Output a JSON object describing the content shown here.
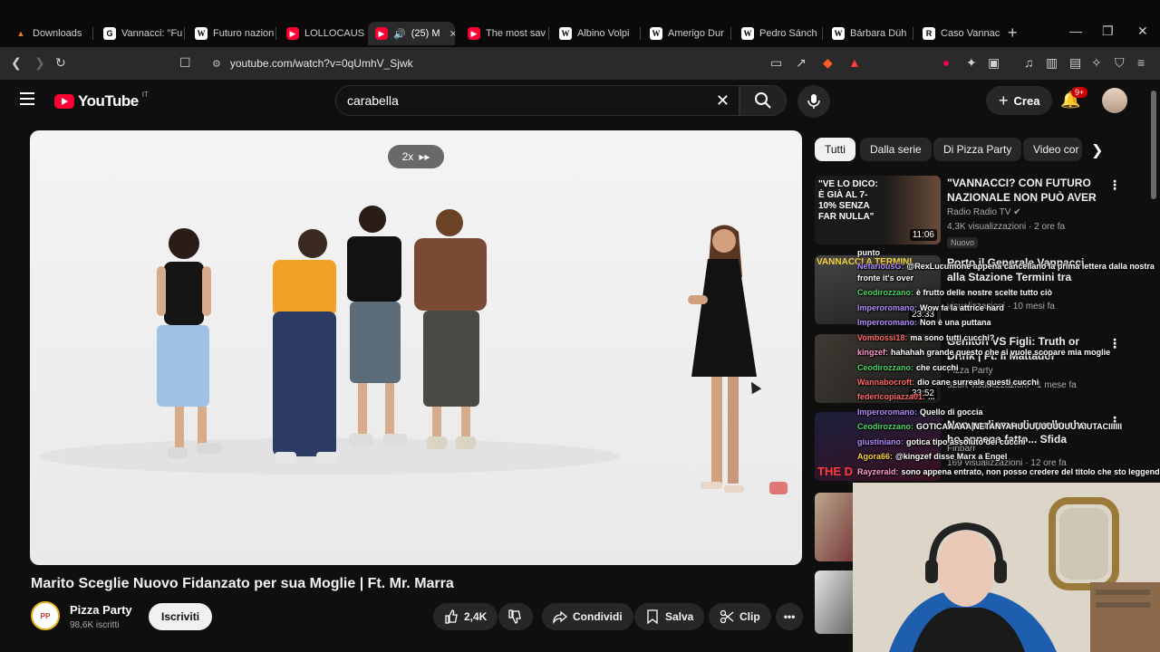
{
  "browser": {
    "tabs": [
      {
        "label": "Downloads",
        "icon": "download-icon"
      },
      {
        "label": "Vannacci: \"Fu",
        "icon": "g-icon"
      },
      {
        "label": "Futuro nazion",
        "icon": "wikipedia-icon"
      },
      {
        "label": "LOLLOCAUST",
        "icon": "youtube-icon"
      },
      {
        "label": "(25) M",
        "icon": "youtube-icon"
      },
      {
        "label": "The most sav",
        "icon": "youtube-icon"
      },
      {
        "label": "Albino Volpi",
        "icon": "wikipedia-icon"
      },
      {
        "label": "Amerigo Dur",
        "icon": "wikipedia-icon"
      },
      {
        "label": "Pedro Sánch",
        "icon": "wikipedia-icon"
      },
      {
        "label": "Bárbara Düh",
        "icon": "wikipedia-icon"
      },
      {
        "label": "Caso Vannac",
        "icon": "r-icon"
      }
    ],
    "url": "youtube.com/watch?v=0qUmhV_Sjwk"
  },
  "youtube": {
    "logo_text": "YouTube",
    "country_code": "IT",
    "search_value": "carabella",
    "create_label": "Crea",
    "notification_badge": "9+"
  },
  "player": {
    "speed_label": "2x"
  },
  "video": {
    "title": "Marito Sceglie Nuovo Fidanzato per sua Moglie | Ft. Mr. Marra",
    "channel": "Pizza Party",
    "subscribers": "98,6K iscritti",
    "subscribe_label": "Iscriviti",
    "likes": "2,4K",
    "share_label": "Condividi",
    "save_label": "Salva",
    "clip_label": "Clip"
  },
  "chips": [
    "Tutti",
    "Dalla serie",
    "Di Pizza Party",
    "Video cor"
  ],
  "recommendations": [
    {
      "title": "\"VANNACCI? CON FUTURO NAZIONALE NON PUÒ AVER ...",
      "channel": "Radio Radio TV",
      "meta": "4,3K visualizzazioni · 2 ore fa",
      "badge": "Nuovo",
      "duration": "11:06",
      "thumb_text": "\"VE LO DICO: È GIÀ AL 7-10% SENZA FAR NULLA\""
    },
    {
      "title": "Porto il Generale Vannacci alla Stazione Termini tra degrado e...",
      "channel": "",
      "meta": "visualizzazioni · 10 mesi fa",
      "badge": "",
      "duration": "23:33",
      "thumb_text": "VANNACCI A TERMINI"
    },
    {
      "title": "Genitori VS Figli: Truth or Drink | Ft. Il Mattador",
      "channel": "Pizza Party",
      "meta": "328K visualizzazioni · 1 mese fa",
      "badge": "",
      "duration": "33:52",
      "thumb_text": ""
    },
    {
      "title": "Non parliamo di quello che ho appena fatto... Sfida giornalier...",
      "channel": "Finbarr",
      "meta": "169 visualizzazioni · 12 ore fa",
      "badge": "Nuovo",
      "duration": "",
      "thumb_text": "THE D"
    }
  ],
  "chat": [
    {
      "user": "punto",
      "msg": "",
      "color": "#ffffff"
    },
    {
      "user": "NefariousG:",
      "msg": "@RexLucumone appena cancellano la prima lettera dalla nostra",
      "color": "#b48cff"
    },
    {
      "user": "",
      "msg": "fronte it's over",
      "color": "#ffffff"
    },
    {
      "user": "Ceodirozzano:",
      "msg": "è frutto delle nostre scelte tutto ciò",
      "color": "#4cd964"
    },
    {
      "user": "Imperoromano:",
      "msg": "Wow fa la attrice hard",
      "color": "#b48cff"
    },
    {
      "user": "Imperoromano:",
      "msg": "Non è una puttana",
      "color": "#b48cff"
    },
    {
      "user": "Vombossi18:",
      "msg": "ma sono tutti cucchi?",
      "color": "#ff6a6a"
    },
    {
      "user": "kingzef:",
      "msg": "hahahah grande questo che si vuole scopare mia moglie",
      "color": "#ff9ad5"
    },
    {
      "user": "Ceodirozzano:",
      "msg": "che cucchi",
      "color": "#4cd964"
    },
    {
      "user": "Wannabocroft:",
      "msg": "dio cane surreale questi cucchi",
      "color": "#ff6a6a"
    },
    {
      "user": "federicopiazza01:",
      "msg": "...",
      "color": "#ff6a6a"
    },
    {
      "user": "Imperoromano:",
      "msg": "Quello di goccia",
      "color": "#b48cff"
    },
    {
      "user": "Ceodirozzano:",
      "msg": "GOTICAAAAA NETANYAHUUUUUUUUUU AIUTACIIIIII",
      "color": "#4cd964"
    },
    {
      "user": "giustiniano:",
      "msg": "gotica tipo assoluto dei cucchi",
      "color": "#b48cff"
    },
    {
      "user": "Agora66:",
      "msg": "@kingzef disse Marx a Engel",
      "color": "#ffd23f"
    },
    {
      "user": "Rayzerald:",
      "msg": "sono appena entrato, non posso credere del titolo che sto leggendo",
      "color": "#ff9ad5"
    }
  ]
}
